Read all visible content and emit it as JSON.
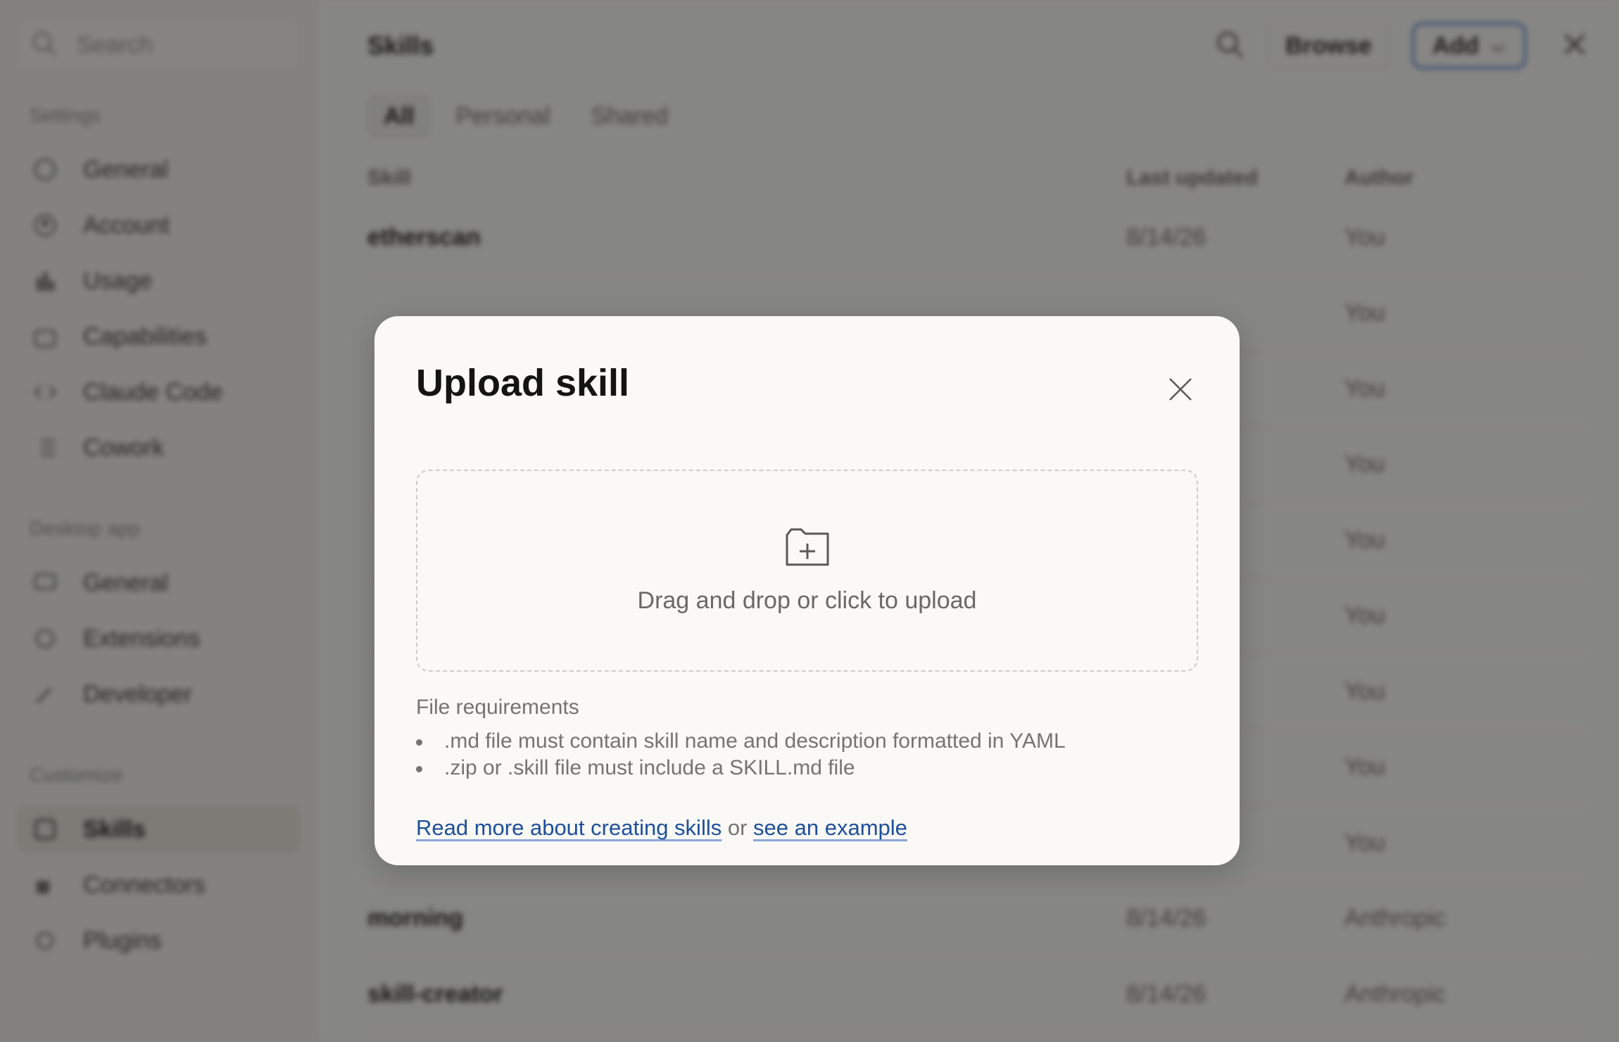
{
  "sidebar": {
    "search_placeholder": "Search",
    "sections": [
      {
        "title": "Settings",
        "items": [
          "General",
          "Account",
          "Usage",
          "Capabilities",
          "Claude Code",
          "Cowork"
        ]
      },
      {
        "title": "Desktop app",
        "items": [
          "General",
          "Extensions",
          "Developer"
        ]
      },
      {
        "title": "Customize",
        "items": [
          "Skills",
          "Connectors",
          "Plugins"
        ]
      }
    ],
    "active_item": "Skills"
  },
  "header": {
    "title": "Skills",
    "browse_label": "Browse",
    "add_label": "Add"
  },
  "tabs": [
    "All",
    "Personal",
    "Shared"
  ],
  "table": {
    "columns": [
      "Skill",
      "Last updated",
      "Author"
    ],
    "rows": [
      [
        "etherscan",
        "8/14/26",
        "You"
      ],
      [
        "",
        "",
        "You"
      ],
      [
        "",
        "",
        "You"
      ],
      [
        "",
        "",
        "You"
      ],
      [
        "",
        "",
        "You"
      ],
      [
        "",
        "",
        "You"
      ],
      [
        "",
        "",
        "You"
      ],
      [
        "",
        "",
        "You"
      ],
      [
        "",
        "",
        "You"
      ],
      [
        "morning",
        "8/14/26",
        "Anthropic"
      ],
      [
        "skill-creator",
        "8/14/26",
        "Anthropic"
      ]
    ]
  },
  "modal": {
    "title": "Upload skill",
    "dropzone_text": "Drag and drop or click to upload",
    "requirements_title": "File requirements",
    "requirements": [
      ".md file must contain skill name and description formatted in YAML",
      ".zip or .skill file must include a SKILL.md file"
    ],
    "link_read_more": "Read more about creating skills",
    "link_separator": "or",
    "link_example": "see an example"
  },
  "colors": {
    "link": "#1e4f9a",
    "add_button_border": "#3b6ed3",
    "overlay": "rgba(18,18,16,0.5)"
  }
}
